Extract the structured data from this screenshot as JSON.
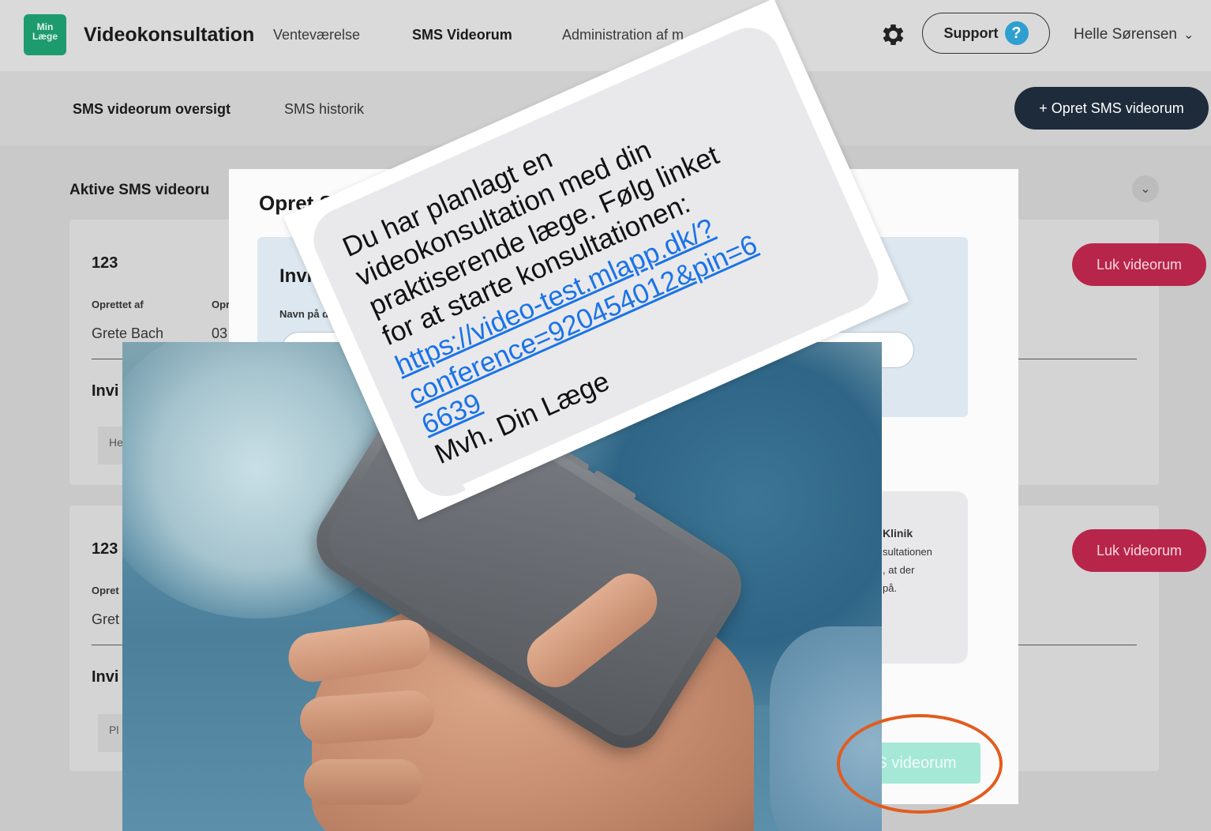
{
  "app": {
    "logo_line1": "Min",
    "logo_line2": "Læge",
    "title": "Videokonsultation"
  },
  "nav": {
    "items": [
      {
        "label": "Venteværelse"
      },
      {
        "label": "SMS Videorum"
      },
      {
        "label": "Administration af m"
      }
    ],
    "support_label": "Support",
    "support_icon": "?",
    "user_name": "Helle Sørensen"
  },
  "subnav": {
    "tab_overview": "SMS videorum oversigt",
    "tab_history": "SMS historik",
    "create_button": "+ Opret SMS videorum"
  },
  "section": {
    "title": "Aktive SMS videoru"
  },
  "cards": [
    {
      "id": "123",
      "created_by_label": "Oprettet af",
      "created_label_2": "Opr",
      "created_by": "Grete Bach",
      "created_value_2": "03",
      "invite_title": "Invi",
      "chip_text": "He",
      "close_button": "Luk videorum"
    },
    {
      "id": "123",
      "created_by_label": "Opret",
      "created_by": "Gret",
      "invite_title": "Invi",
      "chip_text": "Pl",
      "close_button": "Luk videorum"
    }
  ],
  "modal": {
    "title": "Opret S",
    "invite_title": "Invite",
    "name_label": "Navn på delt",
    "preview_label": "e",
    "preview_line1": "Klinik",
    "preview_line2": "sultationen",
    "preview_line3": ", at der",
    "preview_line4": "på.",
    "submit_button": "S videorum"
  },
  "sms": {
    "line1": "Du har planlagt en",
    "line2": "videokonsultation med din",
    "line3": "praktiserende læge. Følg linket",
    "line4": "for at starte konsultationen:",
    "link1": "https://video-test.mlapp.dk/?",
    "link2": "conference=920454012&pin=6",
    "link3": "6639",
    "signature": "Mvh. Din Læge"
  },
  "colors": {
    "brand_green": "#1e9b6e",
    "dark_button": "#1e2b3a",
    "danger": "#b8254a",
    "submit_mint": "#a6e8d6",
    "link_blue": "#1a73e8",
    "highlight_orange": "#e35b1d"
  }
}
